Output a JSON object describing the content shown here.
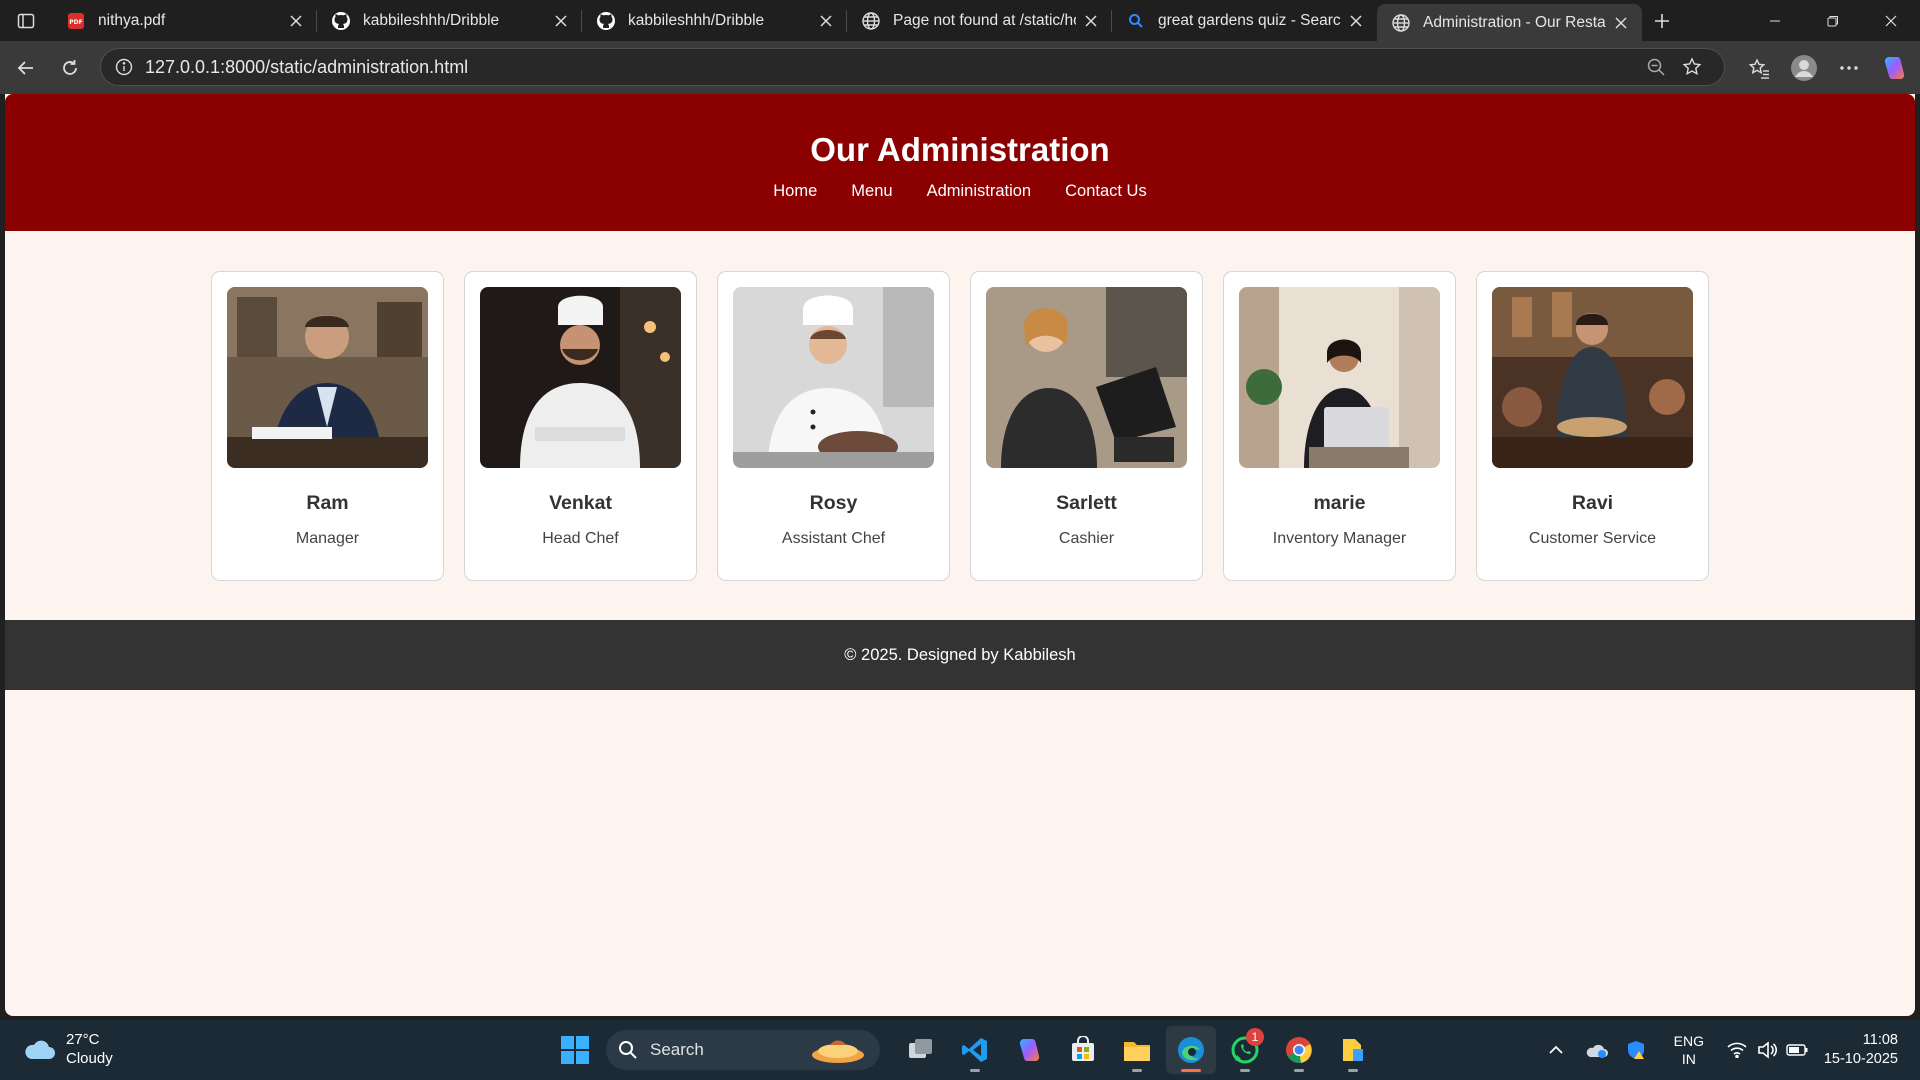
{
  "browser": {
    "tabs": [
      {
        "title": "nithya.pdf",
        "icon": "pdf-icon"
      },
      {
        "title": "kabbileshhh/Dribble",
        "icon": "github-icon"
      },
      {
        "title": "kabbileshhh/Dribble",
        "icon": "github-icon"
      },
      {
        "title": "Page not found at /static/ho",
        "icon": "globe-icon"
      },
      {
        "title": "great gardens quiz - Search",
        "icon": "search-icon"
      },
      {
        "title": "Administration - Our Restau",
        "icon": "globe-icon",
        "active": true
      }
    ],
    "url": "127.0.0.1:8000/static/administration.html"
  },
  "page": {
    "title": "Our Administration",
    "nav": [
      "Home",
      "Menu",
      "Administration",
      "Contact Us"
    ],
    "staff": [
      {
        "name": "Ram",
        "role": "Manager"
      },
      {
        "name": "Venkat",
        "role": "Head Chef"
      },
      {
        "name": "Rosy",
        "role": "Assistant Chef"
      },
      {
        "name": "Sarlett",
        "role": "Cashier"
      },
      {
        "name": "marie",
        "role": "Inventory Manager"
      },
      {
        "name": "Ravi",
        "role": "Customer Service"
      }
    ],
    "footer": "© 2025. Designed by Kabbilesh",
    "colors": {
      "header": "#8b0000",
      "footer": "#333333",
      "background": "#fdf4ef"
    }
  },
  "taskbar": {
    "weather": {
      "temp": "27°C",
      "condition": "Cloudy"
    },
    "search_label": "Search",
    "whatsapp_badge": "1",
    "lang": {
      "line1": "ENG",
      "line2": "IN"
    },
    "clock": {
      "time": "11:08",
      "date": "15-10-2025"
    }
  }
}
